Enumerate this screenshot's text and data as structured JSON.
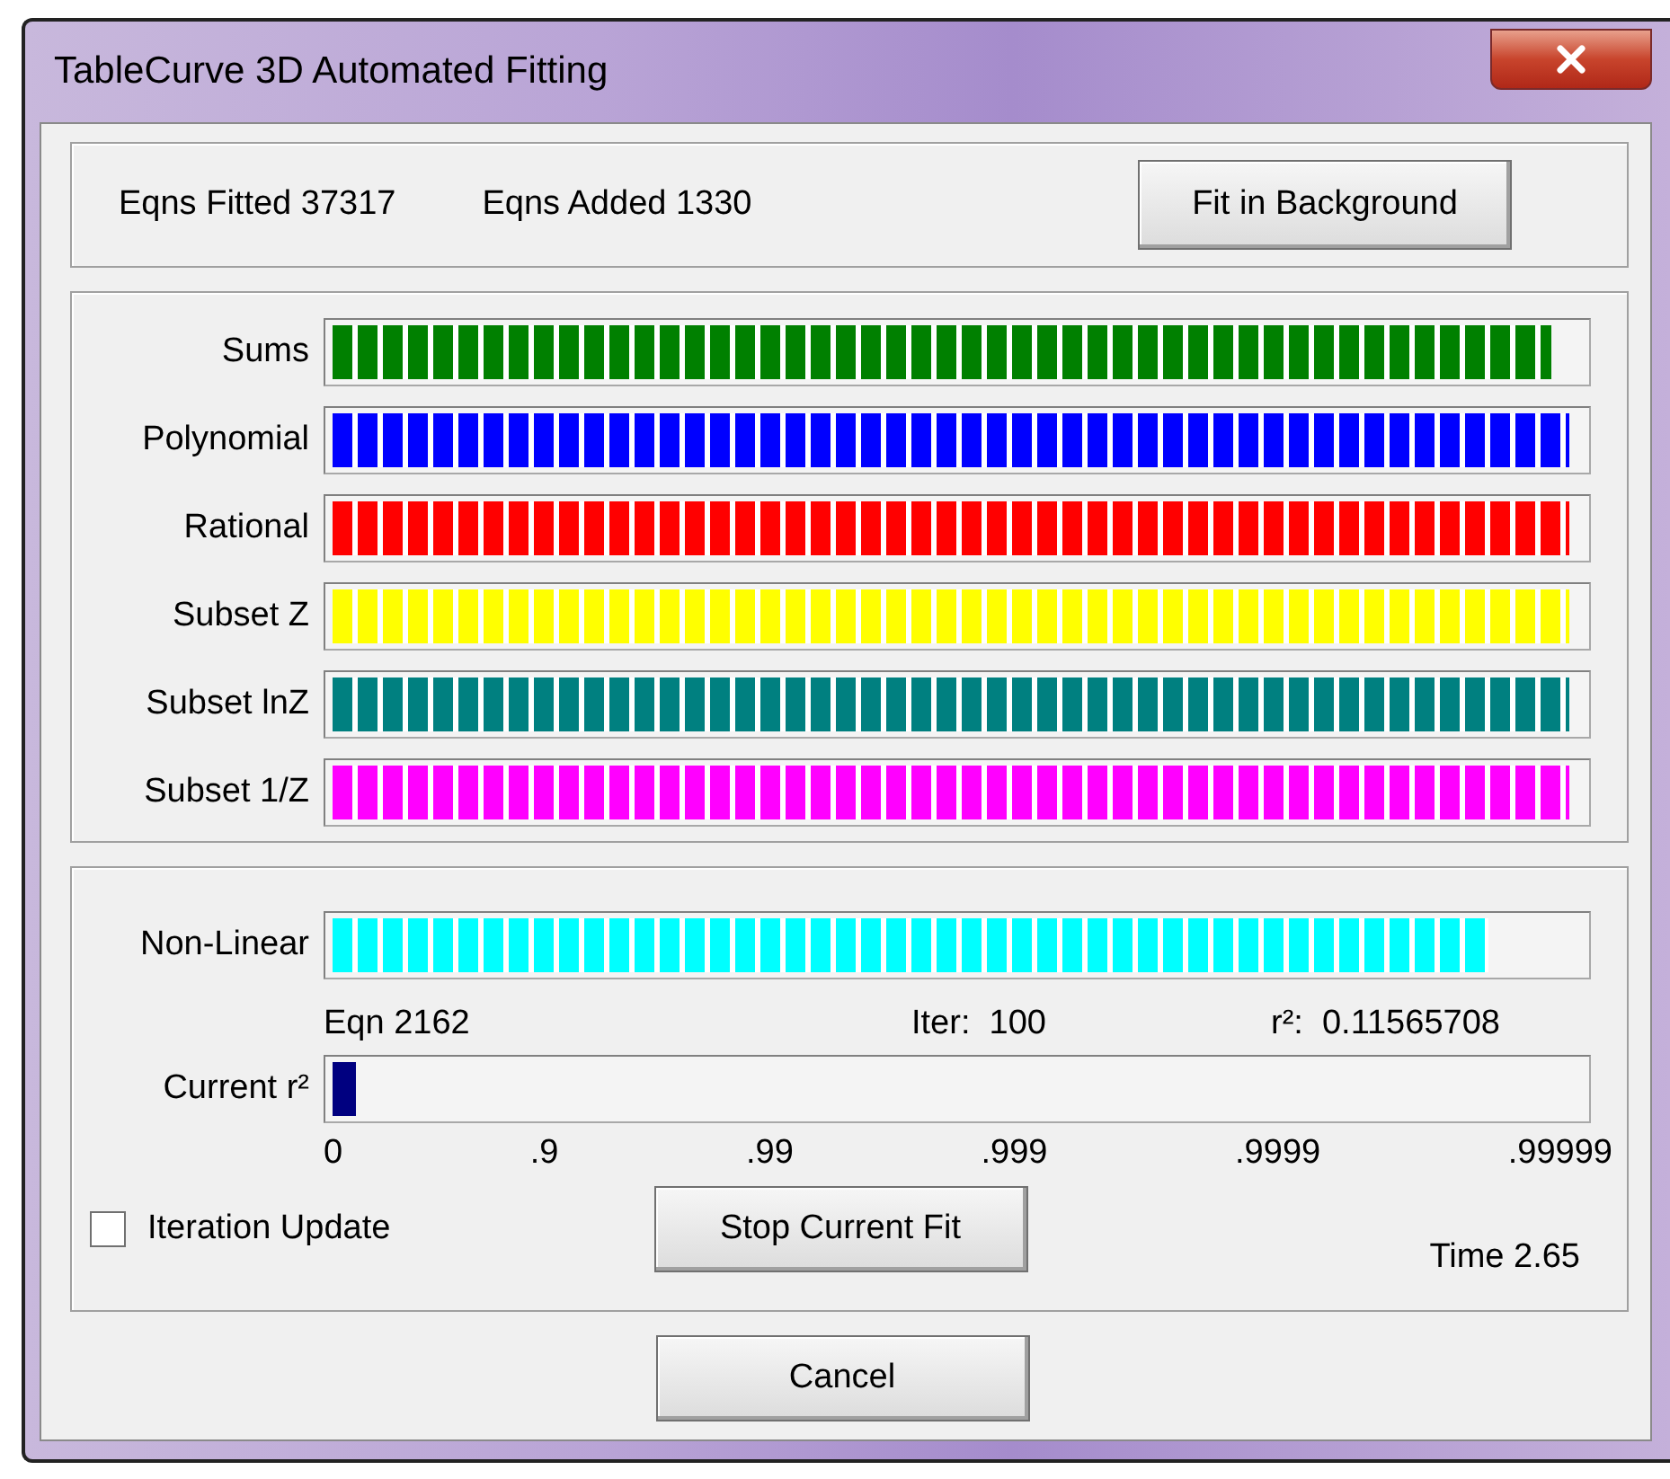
{
  "window": {
    "title": "TableCurve 3D Automated Fitting"
  },
  "summary": {
    "fitted": "Eqns Fitted 37317",
    "added": "Eqns Added 1330",
    "button": "Fit in Background"
  },
  "families": [
    {
      "label": "Sums",
      "color": "#008000",
      "level": 0.975
    },
    {
      "label": "Polynomial",
      "color": "#0000ff",
      "level": 0.99
    },
    {
      "label": "Rational",
      "color": "#ff0000",
      "level": 0.99
    },
    {
      "label": "Subset Z",
      "color": "#ffff00",
      "level": 0.99
    },
    {
      "label": "Subset lnZ",
      "color": "#008080",
      "level": 0.99
    },
    {
      "label": "Subset 1/Z",
      "color": "#ff00ff",
      "level": 0.99
    }
  ],
  "nonlinear": {
    "label": "Non-Linear",
    "color": "#00ffff",
    "level": 0.925,
    "eqn": "Eqn 2162",
    "iter": "Iter:  100",
    "r2": "r²:  0.11565708"
  },
  "current_r2": {
    "label": "Current r²",
    "level": 0.018,
    "ticks": [
      "0",
      ".9",
      ".99",
      ".999",
      ".9999",
      ".99999"
    ]
  },
  "iteration_update": {
    "label": "Iteration Update",
    "checked": false
  },
  "stop_button": "Stop Current Fit",
  "time": "Time 2.65",
  "cancel_button": "Cancel"
}
